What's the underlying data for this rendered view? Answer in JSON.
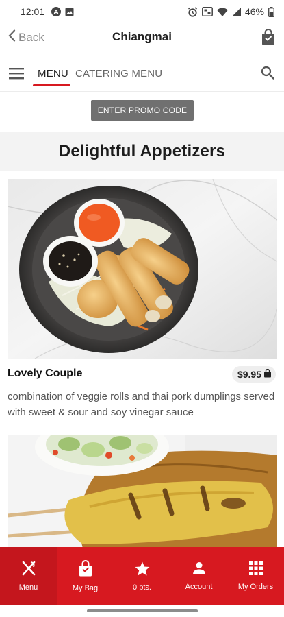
{
  "status_bar": {
    "time": "12:01",
    "battery": "46%"
  },
  "header": {
    "back_label": "Back",
    "title": "Chiangmai"
  },
  "tabs": {
    "menu": "MENU",
    "catering": "CATERING MENU"
  },
  "promo": {
    "label": "ENTER PROMO CODE"
  },
  "section": {
    "title": "Delightful Appetizers"
  },
  "items": [
    {
      "name": "Lovely Couple",
      "price": "$9.95",
      "description": "combination of veggie rolls and thai pork dumplings served with sweet & sour and soy vinegar sauce"
    }
  ],
  "bottom_nav": {
    "menu": "Menu",
    "bag": "My Bag",
    "points": "0 pts.",
    "account": "Account",
    "orders": "My Orders"
  },
  "colors": {
    "brand_red": "#d71920",
    "promo_gray": "#707070"
  }
}
